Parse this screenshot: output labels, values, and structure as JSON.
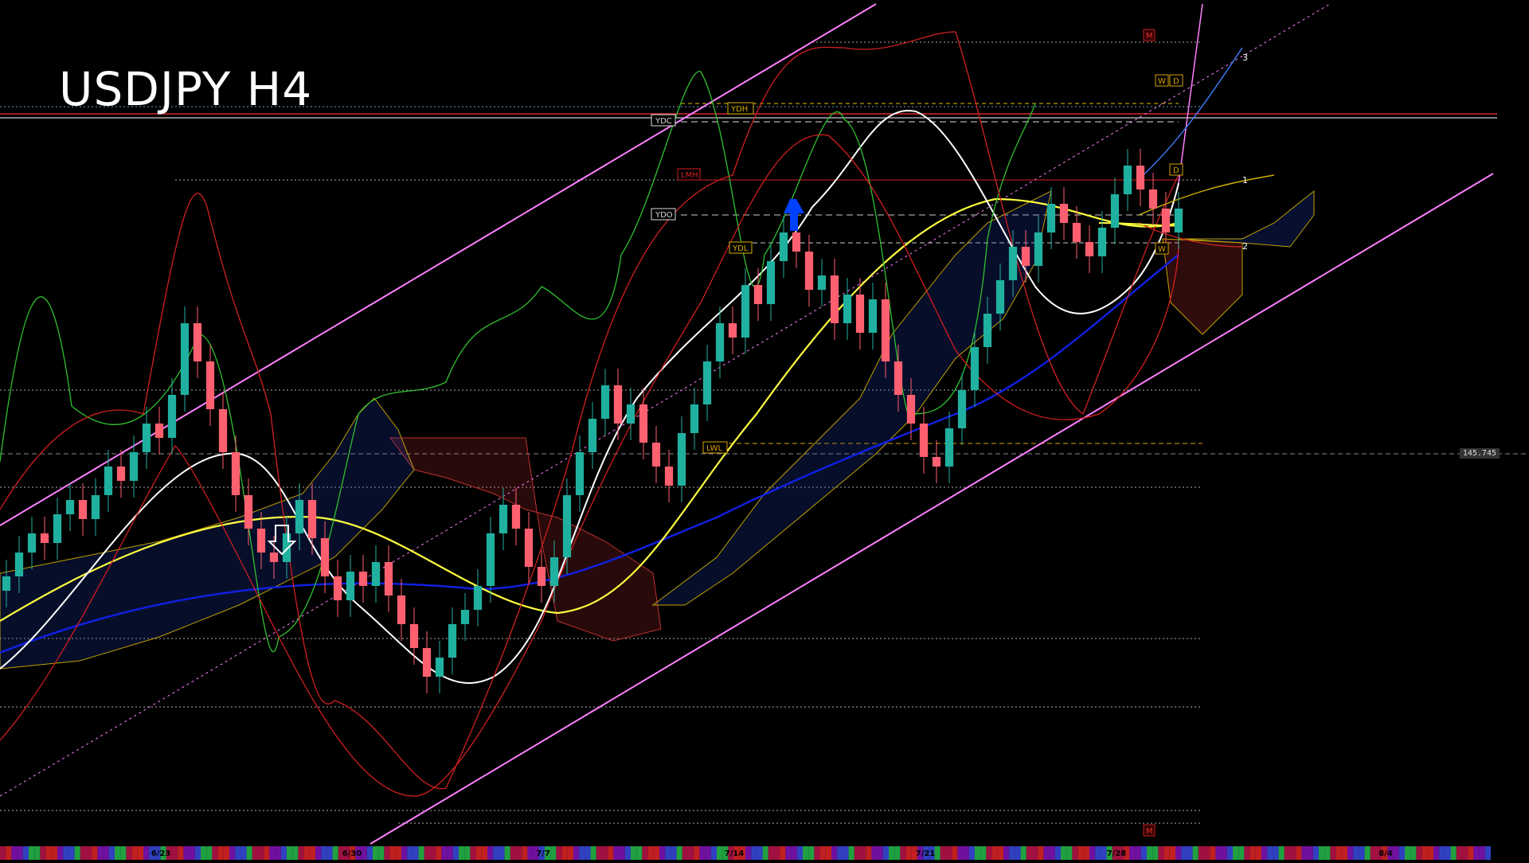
{
  "title": "USDJPY H4",
  "chart_data": {
    "type": "candlestick",
    "symbol": "USDJPY",
    "timeframe": "H4",
    "date_labels": [
      "6/23",
      "6/30",
      "7/7",
      "7/14",
      "7/21",
      "7/28",
      "8/4"
    ],
    "current_price_label": "145.745",
    "level_labels": {
      "ydc": "YDC",
      "ydo": "YDO",
      "ydh": "YDH",
      "ydl": "YDL",
      "lmh": "LMH",
      "lwl": "LWL",
      "w_top": "W",
      "d_top": "D",
      "d_mid": "D",
      "w_low": "W",
      "m_top": "M",
      "m_bottom": "M"
    },
    "projection_labels": [
      "3",
      "1",
      "2"
    ],
    "closes": [
      143.6,
      144.1,
      144.5,
      144.3,
      144.9,
      145.2,
      144.8,
      145.3,
      145.9,
      145.6,
      146.2,
      146.8,
      146.5,
      147.4,
      148.9,
      148.1,
      147.1,
      146.2,
      145.3,
      144.6,
      144.1,
      143.9,
      144.5,
      145.2,
      144.4,
      143.6,
      143.1,
      143.7,
      143.4,
      143.9,
      143.2,
      142.6,
      142.1,
      141.5,
      141.9,
      142.6,
      142.9,
      143.4,
      144.5,
      145.1,
      144.6,
      143.8,
      143.4,
      144.0,
      145.3,
      146.2,
      146.9,
      147.6,
      146.8,
      147.2,
      146.4,
      145.9,
      145.5,
      146.6,
      147.2,
      148.1,
      148.9,
      148.6,
      149.7,
      149.3,
      150.2,
      150.8,
      150.4,
      149.6,
      149.9,
      148.9,
      149.5,
      148.7,
      149.4,
      148.1,
      147.4,
      146.8,
      146.1,
      145.9,
      146.7,
      147.5,
      148.4,
      149.1,
      149.8,
      150.5,
      150.1,
      150.8,
      151.4,
      151.0,
      150.6,
      150.3,
      150.9,
      151.6,
      152.2,
      151.7,
      151.3,
      150.8,
      151.3
    ]
  }
}
